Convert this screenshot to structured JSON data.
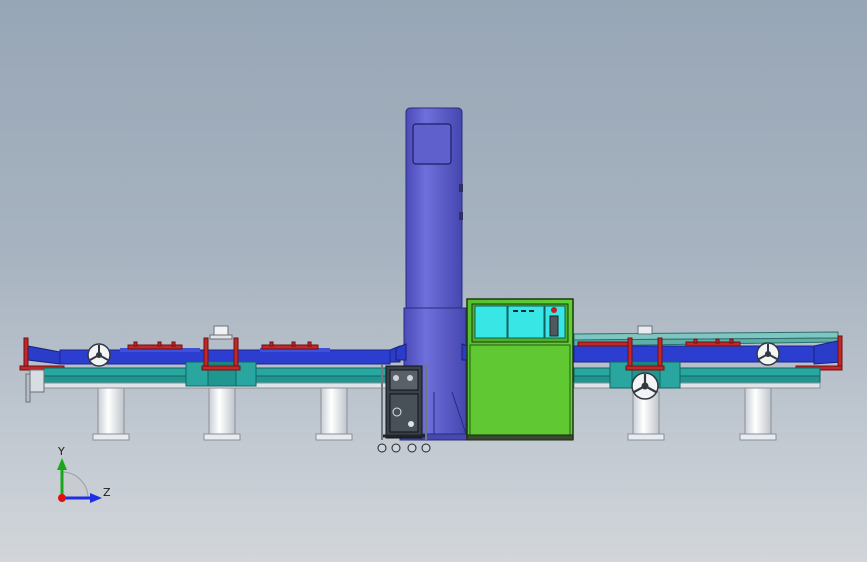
{
  "axes": {
    "y_label": "Y",
    "z_label": "Z",
    "y_color": "#1aa81a",
    "z_color": "#2030e0",
    "origin_color": "#e01010"
  },
  "colors": {
    "column": "#6464d2",
    "cabinet": "#5fc832",
    "cabinet_panel": "#38e6e6",
    "rail_teal": "#2aa6a0",
    "frame_blue": "#2a3cc8",
    "accent_red": "#c0282a",
    "legs": "#e8ecf0"
  }
}
